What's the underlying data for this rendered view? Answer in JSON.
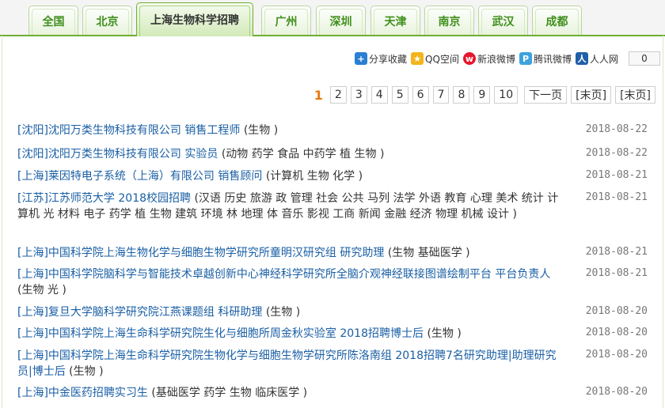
{
  "tabs": [
    {
      "label": "全国"
    },
    {
      "label": "北京"
    },
    {
      "label": "上海生物科学招聘"
    },
    {
      "label": "广州"
    },
    {
      "label": "深圳"
    },
    {
      "label": "天津"
    },
    {
      "label": "南京"
    },
    {
      "label": "武汉"
    },
    {
      "label": "成都"
    }
  ],
  "share": {
    "items": [
      {
        "label": "分享收藏",
        "icon": "plus-icon"
      },
      {
        "label": "QQ空间",
        "icon": "qzone-icon"
      },
      {
        "label": "新浪微博",
        "icon": "weibo-icon"
      },
      {
        "label": "腾讯微博",
        "icon": "tencent-weibo-icon"
      },
      {
        "label": "人人网",
        "icon": "renren-icon"
      }
    ],
    "count": "0"
  },
  "pager": {
    "current": "1",
    "pages": [
      "2",
      "3",
      "4",
      "5",
      "6",
      "7",
      "8",
      "9",
      "10"
    ],
    "next": "下一页",
    "last": "[末页]",
    "last2": "[末页]"
  },
  "jobs": [
    {
      "link": "[沈阳]沈阳万类生物科技有限公司 销售工程师",
      "tags": " (生物 )",
      "date": "2018-08-22"
    },
    {
      "link": "[沈阳]沈阳万类生物科技有限公司 实验员",
      "tags": " (动物 药学 食品 中药学 植 生物 )",
      "date": "2018-08-22"
    },
    {
      "link": "[上海]莱因特电子系统（上海）有限公司 销售顾问",
      "tags": " (计算机 生物 化学 )",
      "date": "2018-08-21"
    },
    {
      "link": "[江苏]江苏师范大学 2018校园招聘",
      "tags": " (汉语 历史 旅游 政 管理 社会 公共 马列 法学 外语 教育 心理 美术 统计 计算机 光 材料 电子 药学 植 生物 建筑 环境 林 地理 体 音乐 影视 工商 新闻 金融 经济 物理 机械 设计 )",
      "date": "2018-08-21"
    },
    {
      "link": "[上海]中国科学院上海生物化学与细胞生物学研究所童明汉研究组 研究助理",
      "tags": " (生物 基础医学 )",
      "date": "2018-08-21"
    },
    {
      "link": "[上海]中国科学院脑科学与智能技术卓越创新中心神经科学研究所全脑介观神经联接图谱绘制平台 平台负责人",
      "tags": " (生物 光 )",
      "date": "2018-08-21"
    },
    {
      "link": "[上海]复旦大学脑科学研究院江燕课题组 科研助理",
      "tags": " (生物 )",
      "date": "2018-08-20"
    },
    {
      "link": "[上海]中国科学院上海生命科学研究院生化与细胞所周金秋实验室 2018招聘博士后",
      "tags": " (生物 )",
      "date": "2018-08-20"
    },
    {
      "link": "[上海]中国科学院上海生命科学研究院生物化学与细胞生物学研究所陈洛南组 2018招聘7名研究助理|助理研究员|博士后",
      "tags": " (生物 )",
      "date": "2018-08-20"
    },
    {
      "link": "[上海]中金医药招聘实习生",
      "tags": " (基础医学 药学 生物 临床医学 )",
      "date": "2018-08-20"
    }
  ],
  "colors": {
    "accent": "#6fae30",
    "tab_text": "#3f8f1c",
    "link": "#1a5fa5",
    "current_page": "#e8780c"
  }
}
